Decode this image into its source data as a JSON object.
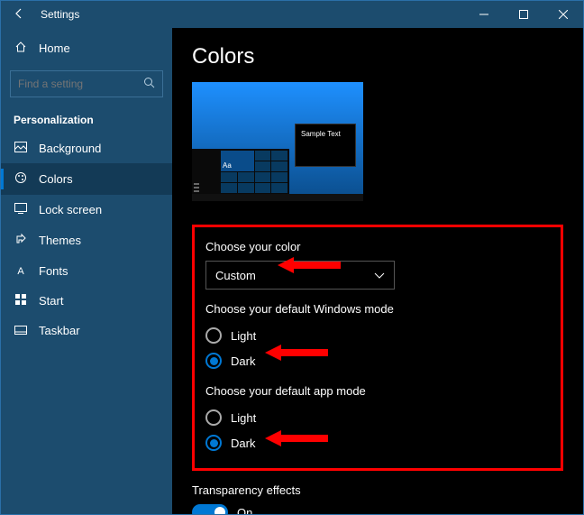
{
  "titlebar": {
    "title": "Settings"
  },
  "sidebar": {
    "home": "Home",
    "search_placeholder": "Find a setting",
    "section": "Personalization",
    "items": [
      {
        "label": "Background"
      },
      {
        "label": "Colors"
      },
      {
        "label": "Lock screen"
      },
      {
        "label": "Themes"
      },
      {
        "label": "Fonts"
      },
      {
        "label": "Start"
      },
      {
        "label": "Taskbar"
      }
    ]
  },
  "content": {
    "heading": "Colors",
    "preview": {
      "sample_text": "Sample Text",
      "aa": "Aa"
    },
    "choose_color_label": "Choose your color",
    "choose_color_value": "Custom",
    "windows_mode_label": "Choose your default Windows mode",
    "windows_mode": {
      "light": "Light",
      "dark": "Dark",
      "selected": "dark"
    },
    "app_mode_label": "Choose your default app mode",
    "app_mode": {
      "light": "Light",
      "dark": "Dark",
      "selected": "dark"
    },
    "transparency_label": "Transparency effects",
    "transparency_value": "On"
  }
}
